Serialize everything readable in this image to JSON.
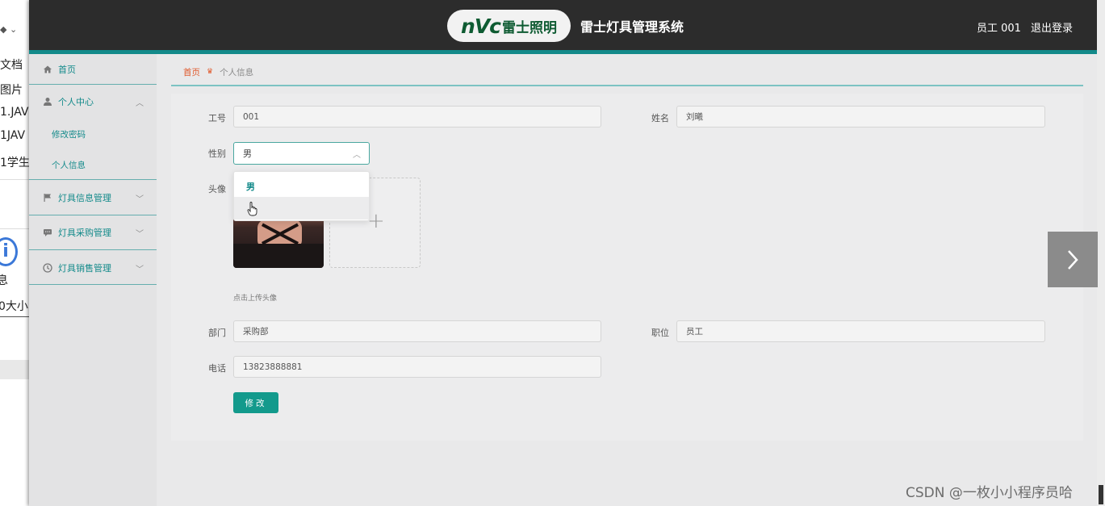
{
  "background_window": {
    "items": [
      "文档",
      "图片",
      "1.JAV",
      "1JAV",
      "1学生",
      "息",
      "0大小"
    ]
  },
  "header": {
    "logo_mark": "nVc",
    "logo_text": "雷士照明",
    "system_title": "雷士灯具管理系统",
    "user_label": "员工 001",
    "logout": "退出登录"
  },
  "sidebar": {
    "home": "首页",
    "personal_center": "个人中心",
    "change_password": "修改密码",
    "personal_info": "个人信息",
    "lamp_info_mgmt": "灯具信息管理",
    "lamp_purchase_mgmt": "灯具采购管理",
    "lamp_sales_mgmt": "灯具销售管理"
  },
  "breadcrumb": {
    "home": "首页",
    "current": "个人信息"
  },
  "form": {
    "employee_id_label": "工号",
    "employee_id_value": "001",
    "name_label": "姓名",
    "name_value": "刘曦",
    "gender_label": "性别",
    "gender_value": "男",
    "gender_options": [
      "男",
      ""
    ],
    "avatar_label": "头像",
    "upload_hint": "点击上传头像",
    "department_label": "部门",
    "department_value": "采购部",
    "position_label": "职位",
    "position_value": "员工",
    "phone_label": "电话",
    "phone_value": "13823888881",
    "submit_label": "修改"
  },
  "watermark": "CSDN @一枚小小程序员哈",
  "colors": {
    "header_bg": "#2c2c2c",
    "accent_teal": "#138a8a",
    "button_teal": "#139a8c",
    "breadcrumb_home": "#e0582a"
  }
}
